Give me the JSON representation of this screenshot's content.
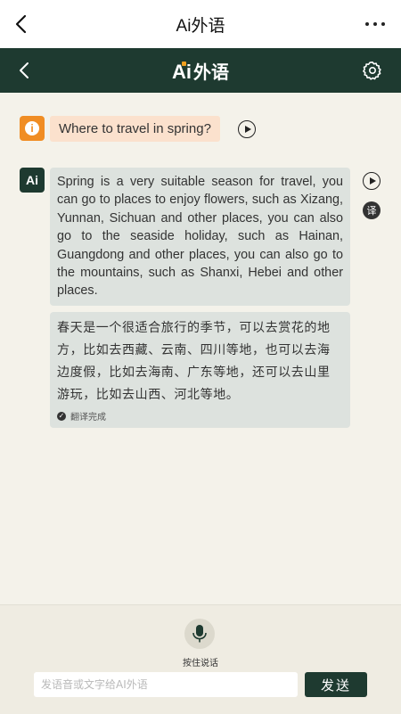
{
  "topbar": {
    "title": "Ai外语"
  },
  "app_header": {
    "logo_ai": "Ai",
    "logo_cn": "外语",
    "accent_color": "#f0a020",
    "bg_color": "#1e3a30"
  },
  "messages": {
    "user": {
      "text": "Where to travel in spring?"
    },
    "ai": {
      "avatar_label": "Ai",
      "text": "Spring is a very suitable season for travel, you can go to places to enjoy flowers, such as Xizang, Yunnan, Sichuan and other places, you can also go to the seaside holiday, such as Hainan, Guangdong and other places, you can also go to the mountains, such as Shanxi, Hebei and other places.",
      "translate_label": "译",
      "translation": "春天是一个很适合旅行的季节，可以去赏花的地方，比如去西藏、云南、四川等地，也可以去海边度假，比如去海南、广东等地，还可以去山里游玩，比如去山西、河北等地。",
      "translation_status": "翻译完成"
    }
  },
  "input_bar": {
    "mic_label": "按住说话",
    "placeholder": "发语音或文字给AI外语",
    "value": "",
    "send_label": "发送"
  },
  "icons": {
    "back": "chevron-left-icon",
    "more": "more-horizontal-icon",
    "settings": "gear-icon",
    "play": "play-circle-icon",
    "mic": "microphone-icon",
    "check": "check-circle-icon"
  }
}
